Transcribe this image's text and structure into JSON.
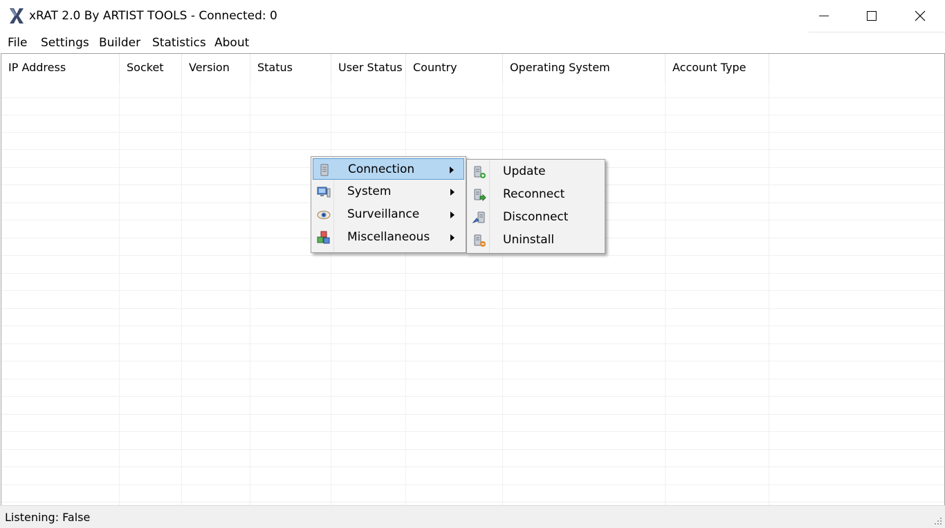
{
  "window": {
    "title": "xRAT 2.0 By ARTIST TOOLS - Connected: 0",
    "app_icon": "x-logo-icon",
    "controls": [
      "minimize-icon",
      "maximize-icon",
      "close-icon"
    ]
  },
  "menubar": {
    "items": [
      "File",
      "Settings",
      "Builder",
      "Statistics",
      "About"
    ]
  },
  "table": {
    "columns": [
      "IP Address",
      "Socket",
      "Version",
      "Status",
      "User Status",
      "Country",
      "Operating System",
      "Account Type"
    ],
    "rows": []
  },
  "context_menu": {
    "items": [
      {
        "label": "Connection",
        "icon": "server-icon",
        "selected": true
      },
      {
        "label": "System",
        "icon": "computer-icon",
        "selected": false
      },
      {
        "label": "Surveillance",
        "icon": "eye-icon",
        "selected": false
      },
      {
        "label": "Miscellaneous",
        "icon": "cubes-icon",
        "selected": false
      }
    ]
  },
  "submenu": {
    "items": [
      {
        "label": "Update",
        "icon": "server-add-icon"
      },
      {
        "label": "Reconnect",
        "icon": "server-go-icon"
      },
      {
        "label": "Disconnect",
        "icon": "server-disconnect-icon"
      },
      {
        "label": "Uninstall",
        "icon": "server-delete-icon"
      }
    ]
  },
  "statusbar": {
    "text": "Listening: False"
  },
  "colors": {
    "selection_bg": "#b6d7f2",
    "selection_border": "#5a9ad4",
    "menu_bg": "#f2f2f2",
    "status_bg": "#f0f0f0"
  }
}
